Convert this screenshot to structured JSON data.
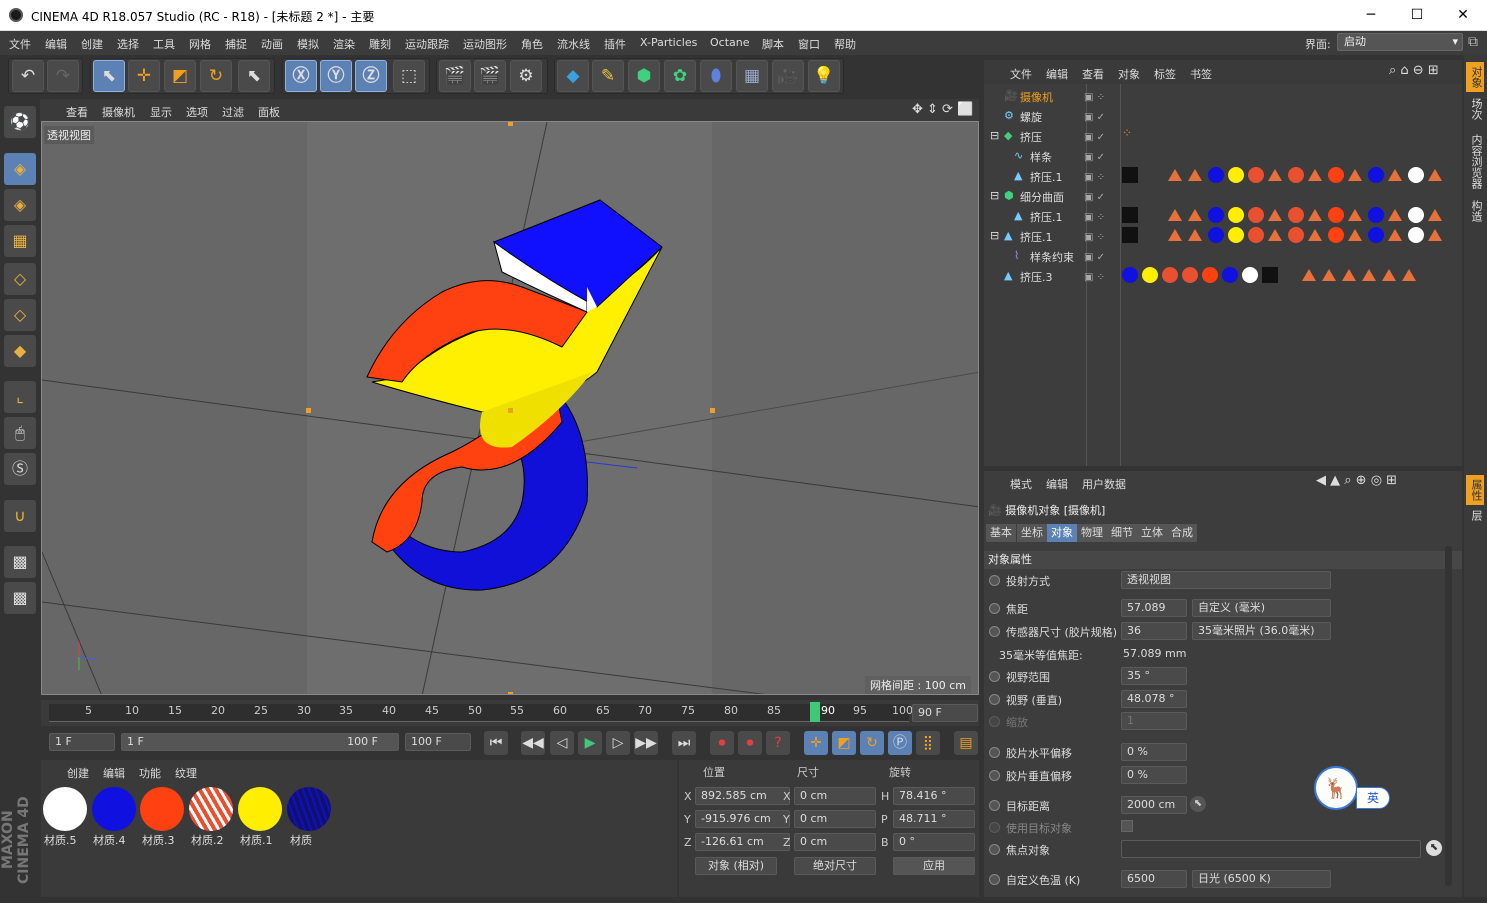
{
  "window": {
    "title": "CINEMA 4D R18.057 Studio (RC - R18) - [未标题 2 *] - 主要",
    "min": "─",
    "max": "☐",
    "close": "✕"
  },
  "menu": [
    "文件",
    "编辑",
    "创建",
    "选择",
    "工具",
    "网格",
    "捕捉",
    "动画",
    "模拟",
    "渲染",
    "雕刻",
    "运动跟踪",
    "运动图形",
    "角色",
    "流水线",
    "插件",
    "X-Particles",
    "Octane",
    "脚本",
    "窗口",
    "帮助"
  ],
  "layout": {
    "label": "界面:",
    "value": "启动"
  },
  "viewport": {
    "menu": [
      "查看",
      "摄像机",
      "显示",
      "选项",
      "过滤",
      "面板"
    ],
    "label": "透视视图",
    "grid": "网格间距 : 100 cm"
  },
  "timeline": {
    "ticks": [
      "5",
      "10",
      "15",
      "20",
      "25",
      "30",
      "35",
      "40",
      "45",
      "50",
      "55",
      "60",
      "65",
      "70",
      "75",
      "80",
      "85",
      "90",
      "95",
      "100"
    ],
    "current": "90",
    "current_field": "90 F",
    "start": "1 F",
    "range_start": "1 F",
    "range_end": "100 F",
    "end": "100 F"
  },
  "materials": {
    "menu": [
      "创建",
      "编辑",
      "功能",
      "纹理"
    ],
    "items": [
      {
        "name": "材质.5",
        "color": "#ffffff"
      },
      {
        "name": "材质.4",
        "color": "#1010e0"
      },
      {
        "name": "材质.3",
        "color": "#ff4010"
      },
      {
        "name": "材质.2",
        "color": "#e85030"
      },
      {
        "name": "材质.1",
        "color": "#ffee00"
      },
      {
        "name": "材质",
        "color": "#101070"
      }
    ]
  },
  "coords": {
    "headers": [
      "位置",
      "尺寸",
      "旋转"
    ],
    "rows": [
      {
        "axis": "X",
        "pos": "892.585 cm",
        "size_axis": "X",
        "size": "0 cm",
        "rot_axis": "H",
        "rot": "78.416 °"
      },
      {
        "axis": "Y",
        "pos": "-915.976 cm",
        "size_axis": "Y",
        "size": "0 cm",
        "rot_axis": "P",
        "rot": "48.711 °"
      },
      {
        "axis": "Z",
        "pos": "-126.61 cm",
        "size_axis": "Z",
        "size": "0 cm",
        "rot_axis": "B",
        "rot": "0 °"
      }
    ],
    "mode": "对象 (相对)",
    "size_mode": "绝对尺寸",
    "apply": "应用"
  },
  "objects": {
    "menu": [
      "文件",
      "编辑",
      "查看",
      "对象",
      "标签",
      "书签"
    ],
    "rows": [
      {
        "name": "摄像机",
        "highlight": true
      },
      {
        "name": "螺旋",
        "highlight": false
      },
      {
        "name": "挤压",
        "highlight": false
      },
      {
        "name": "样条",
        "highlight": false
      },
      {
        "name": "挤压.1",
        "highlight": false
      },
      {
        "name": "细分曲面",
        "highlight": false
      },
      {
        "name": "挤压.1",
        "highlight": false
      },
      {
        "name": "挤压.1",
        "highlight": false
      },
      {
        "name": "样条约束",
        "highlight": false
      },
      {
        "name": "挤压.3",
        "highlight": false
      }
    ]
  },
  "attributes": {
    "menu": [
      "模式",
      "编辑",
      "用户数据"
    ],
    "object_title": "摄像机对象 [摄像机]",
    "tabs": [
      "基本",
      "坐标",
      "对象",
      "物理",
      "细节",
      "立体",
      "合成"
    ],
    "active_tab": "对象",
    "section": "对象属性",
    "projection_label": "投射方式",
    "projection_value": "透视视图",
    "focal_label": "焦距",
    "focal_value": "57.089",
    "focal_preset": "自定义 (毫米)",
    "sensor_label": "传感器尺寸 (胶片规格)",
    "sensor_value": "36",
    "sensor_preset": "35毫米照片 (36.0毫米)",
    "equiv_label": "35毫米等值焦距:",
    "equiv_value": "57.089 mm",
    "fov_label": "视野范围",
    "fov_value": "35 °",
    "fovv_label": "视野 (垂直)",
    "fovv_value": "48.078 °",
    "zoom_label": "缩放",
    "zoom_value": "1",
    "offx_label": "胶片水平偏移",
    "offx_value": "0 %",
    "offy_label": "胶片垂直偏移",
    "offy_value": "0 %",
    "target_label": "目标距离",
    "target_value": "2000 cm",
    "use_target_label": "使用目标对象",
    "focus_label": "焦点对象",
    "temp_label": "自定义色温 (K)",
    "temp_value": "6500",
    "temp_preset": "日光 (6500 K)"
  },
  "side_tabs": [
    "对象",
    "场次",
    "内容浏览器",
    "构造"
  ],
  "side_tabs2": [
    "属性",
    "层"
  ],
  "brand": "MAXON CINEMA 4D",
  "ime": "英"
}
